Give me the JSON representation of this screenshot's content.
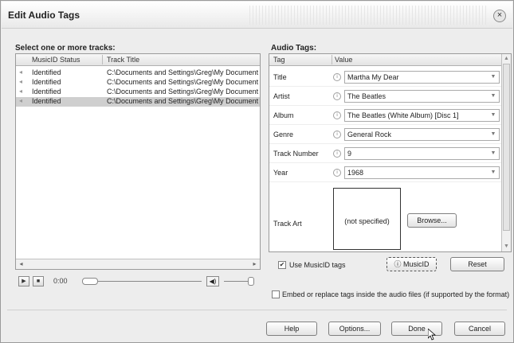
{
  "window": {
    "title": "Edit Audio Tags",
    "close_glyph": "×"
  },
  "tracks": {
    "section_label": "Select one or more tracks:",
    "columns": [
      "MusicID Status",
      "Track Title"
    ],
    "rows": [
      {
        "status": "Identified",
        "path": "C:\\Documents and Settings\\Greg\\My Documents"
      },
      {
        "status": "Identified",
        "path": "C:\\Documents and Settings\\Greg\\My Documents"
      },
      {
        "status": "Identified",
        "path": "C:\\Documents and Settings\\Greg\\My Documents"
      },
      {
        "status": "Identified",
        "path": "C:\\Documents and Settings\\Greg\\My Documents"
      }
    ],
    "selected_row": 3
  },
  "player": {
    "time": "0:00",
    "play_glyph": "▶",
    "stop_glyph": "■",
    "volume_glyph": "◀)"
  },
  "audio_tags": {
    "section_label": "Audio Tags:",
    "columns": [
      "Tag",
      "Value"
    ],
    "rows": [
      {
        "tag": "Title",
        "value": "Martha My Dear"
      },
      {
        "tag": "Artist",
        "value": "The Beatles"
      },
      {
        "tag": "Album",
        "value": "The Beatles (White Album) [Disc 1]"
      },
      {
        "tag": "Genre",
        "value": "General Rock"
      },
      {
        "tag": "Track Number",
        "value": "9"
      },
      {
        "tag": "Year",
        "value": "1968"
      }
    ],
    "track_art": {
      "label": "Track Art",
      "placeholder": "(not specified)",
      "browse_label": "Browse..."
    },
    "use_musicid_label": "Use MusicID tags",
    "use_musicid_checked": true,
    "musicid_button": "MusicID",
    "reset_button": "Reset"
  },
  "embed": {
    "label": "Embed or replace tags inside the audio files (if supported by the format)",
    "checked": false
  },
  "footer": {
    "help": "Help",
    "options": "Options...",
    "done": "Done",
    "cancel": "Cancel"
  },
  "icons": {
    "info_icon": "info-icon",
    "dropdown_icon": "chevron-down-icon",
    "close_icon": "close-icon"
  }
}
